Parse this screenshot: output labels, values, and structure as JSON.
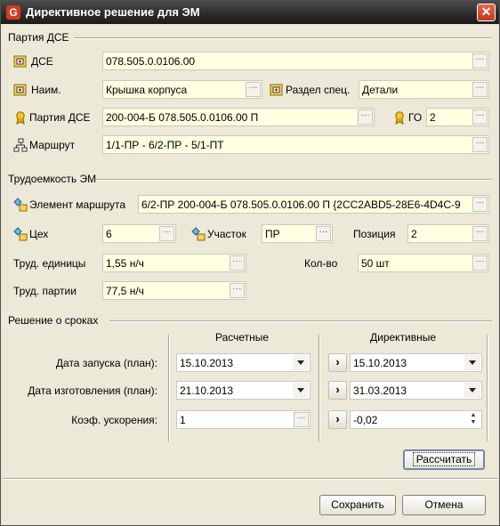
{
  "window": {
    "title": "Директивное решение для ЭМ",
    "app_icon": "G",
    "close": "✕"
  },
  "party": {
    "section_title": "Партия ДСЕ",
    "dse_label": "ДСЕ",
    "dse_value": "078.505.0.0106.00",
    "name_label": "Наим.",
    "name_value": "Крышка корпуса",
    "spec_label": "Раздел спец.",
    "spec_value": "Детали",
    "party_label": "Партия ДСЕ",
    "party_value": "200-004-Б 078.505.0.0106.00 П",
    "go_label": "ГО",
    "go_value": "2",
    "route_label": "Маршрут",
    "route_value": "1/1-ПР - 6/2-ПР - 5/1-ПТ"
  },
  "labor": {
    "section_title": "Трудоемкость ЭМ",
    "element_label": "Элемент маршрута",
    "element_value": "6/2-ПР 200-004-Б 078.505.0.0106.00 П {2CC2ABD5-28E6-4D4C-9",
    "shop_label": "Цех",
    "shop_value": "6",
    "area_label": "Участок",
    "area_value": "ПР",
    "position_label": "Позиция",
    "position_value": "2",
    "unit_labor_label": "Труд. единицы",
    "unit_labor_value": "1,55 н/ч",
    "qty_label": "Кол-во",
    "qty_value": "50 шт",
    "party_labor_label": "Труд. партии",
    "party_labor_value": "77,5 н/ч"
  },
  "deadlines": {
    "section_title": "Решение о сроках",
    "col_calc": "Расчетные",
    "col_directive": "Директивные",
    "rows": [
      {
        "label": "Дата запуска (план):",
        "calc": "15.10.2013",
        "directive": "15.10.2013"
      },
      {
        "label": "Дата изготовления (план):",
        "calc": "21.10.2013",
        "directive": "31.03.2013"
      },
      {
        "label": "Коэф. ускорения:",
        "calc": "1",
        "directive": "-0,02"
      }
    ],
    "calc_button": "Рассчитать"
  },
  "footer": {
    "save": "Сохранить",
    "cancel": "Отмена"
  },
  "icons": {
    "dots": "···",
    "arrow": "›"
  }
}
